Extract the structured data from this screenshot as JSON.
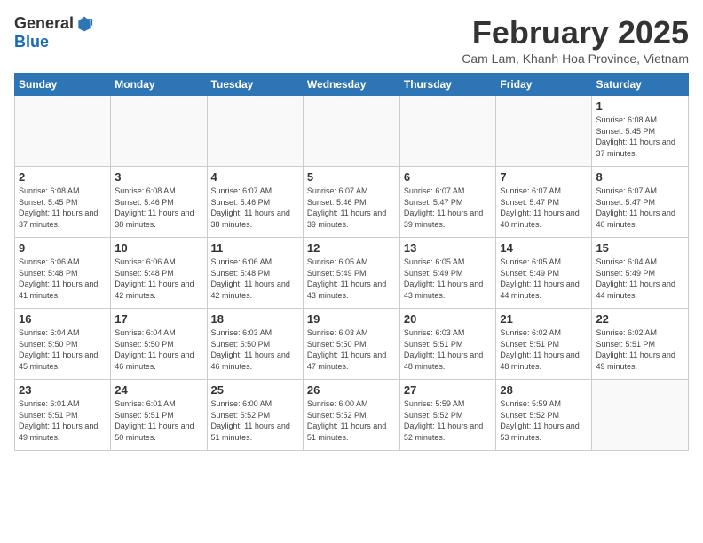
{
  "logo": {
    "general": "General",
    "blue": "Blue"
  },
  "header": {
    "month": "February 2025",
    "location": "Cam Lam, Khanh Hoa Province, Vietnam"
  },
  "weekdays": [
    "Sunday",
    "Monday",
    "Tuesday",
    "Wednesday",
    "Thursday",
    "Friday",
    "Saturday"
  ],
  "weeks": [
    [
      {
        "day": "",
        "info": ""
      },
      {
        "day": "",
        "info": ""
      },
      {
        "day": "",
        "info": ""
      },
      {
        "day": "",
        "info": ""
      },
      {
        "day": "",
        "info": ""
      },
      {
        "day": "",
        "info": ""
      },
      {
        "day": "1",
        "info": "Sunrise: 6:08 AM\nSunset: 5:45 PM\nDaylight: 11 hours and 37 minutes."
      }
    ],
    [
      {
        "day": "2",
        "info": "Sunrise: 6:08 AM\nSunset: 5:45 PM\nDaylight: 11 hours and 37 minutes."
      },
      {
        "day": "3",
        "info": "Sunrise: 6:08 AM\nSunset: 5:46 PM\nDaylight: 11 hours and 38 minutes."
      },
      {
        "day": "4",
        "info": "Sunrise: 6:07 AM\nSunset: 5:46 PM\nDaylight: 11 hours and 38 minutes."
      },
      {
        "day": "5",
        "info": "Sunrise: 6:07 AM\nSunset: 5:46 PM\nDaylight: 11 hours and 39 minutes."
      },
      {
        "day": "6",
        "info": "Sunrise: 6:07 AM\nSunset: 5:47 PM\nDaylight: 11 hours and 39 minutes."
      },
      {
        "day": "7",
        "info": "Sunrise: 6:07 AM\nSunset: 5:47 PM\nDaylight: 11 hours and 40 minutes."
      },
      {
        "day": "8",
        "info": "Sunrise: 6:07 AM\nSunset: 5:47 PM\nDaylight: 11 hours and 40 minutes."
      }
    ],
    [
      {
        "day": "9",
        "info": "Sunrise: 6:06 AM\nSunset: 5:48 PM\nDaylight: 11 hours and 41 minutes."
      },
      {
        "day": "10",
        "info": "Sunrise: 6:06 AM\nSunset: 5:48 PM\nDaylight: 11 hours and 42 minutes."
      },
      {
        "day": "11",
        "info": "Sunrise: 6:06 AM\nSunset: 5:48 PM\nDaylight: 11 hours and 42 minutes."
      },
      {
        "day": "12",
        "info": "Sunrise: 6:05 AM\nSunset: 5:49 PM\nDaylight: 11 hours and 43 minutes."
      },
      {
        "day": "13",
        "info": "Sunrise: 6:05 AM\nSunset: 5:49 PM\nDaylight: 11 hours and 43 minutes."
      },
      {
        "day": "14",
        "info": "Sunrise: 6:05 AM\nSunset: 5:49 PM\nDaylight: 11 hours and 44 minutes."
      },
      {
        "day": "15",
        "info": "Sunrise: 6:04 AM\nSunset: 5:49 PM\nDaylight: 11 hours and 44 minutes."
      }
    ],
    [
      {
        "day": "16",
        "info": "Sunrise: 6:04 AM\nSunset: 5:50 PM\nDaylight: 11 hours and 45 minutes."
      },
      {
        "day": "17",
        "info": "Sunrise: 6:04 AM\nSunset: 5:50 PM\nDaylight: 11 hours and 46 minutes."
      },
      {
        "day": "18",
        "info": "Sunrise: 6:03 AM\nSunset: 5:50 PM\nDaylight: 11 hours and 46 minutes."
      },
      {
        "day": "19",
        "info": "Sunrise: 6:03 AM\nSunset: 5:50 PM\nDaylight: 11 hours and 47 minutes."
      },
      {
        "day": "20",
        "info": "Sunrise: 6:03 AM\nSunset: 5:51 PM\nDaylight: 11 hours and 48 minutes."
      },
      {
        "day": "21",
        "info": "Sunrise: 6:02 AM\nSunset: 5:51 PM\nDaylight: 11 hours and 48 minutes."
      },
      {
        "day": "22",
        "info": "Sunrise: 6:02 AM\nSunset: 5:51 PM\nDaylight: 11 hours and 49 minutes."
      }
    ],
    [
      {
        "day": "23",
        "info": "Sunrise: 6:01 AM\nSunset: 5:51 PM\nDaylight: 11 hours and 49 minutes."
      },
      {
        "day": "24",
        "info": "Sunrise: 6:01 AM\nSunset: 5:51 PM\nDaylight: 11 hours and 50 minutes."
      },
      {
        "day": "25",
        "info": "Sunrise: 6:00 AM\nSunset: 5:52 PM\nDaylight: 11 hours and 51 minutes."
      },
      {
        "day": "26",
        "info": "Sunrise: 6:00 AM\nSunset: 5:52 PM\nDaylight: 11 hours and 51 minutes."
      },
      {
        "day": "27",
        "info": "Sunrise: 5:59 AM\nSunset: 5:52 PM\nDaylight: 11 hours and 52 minutes."
      },
      {
        "day": "28",
        "info": "Sunrise: 5:59 AM\nSunset: 5:52 PM\nDaylight: 11 hours and 53 minutes."
      },
      {
        "day": "",
        "info": ""
      }
    ]
  ]
}
